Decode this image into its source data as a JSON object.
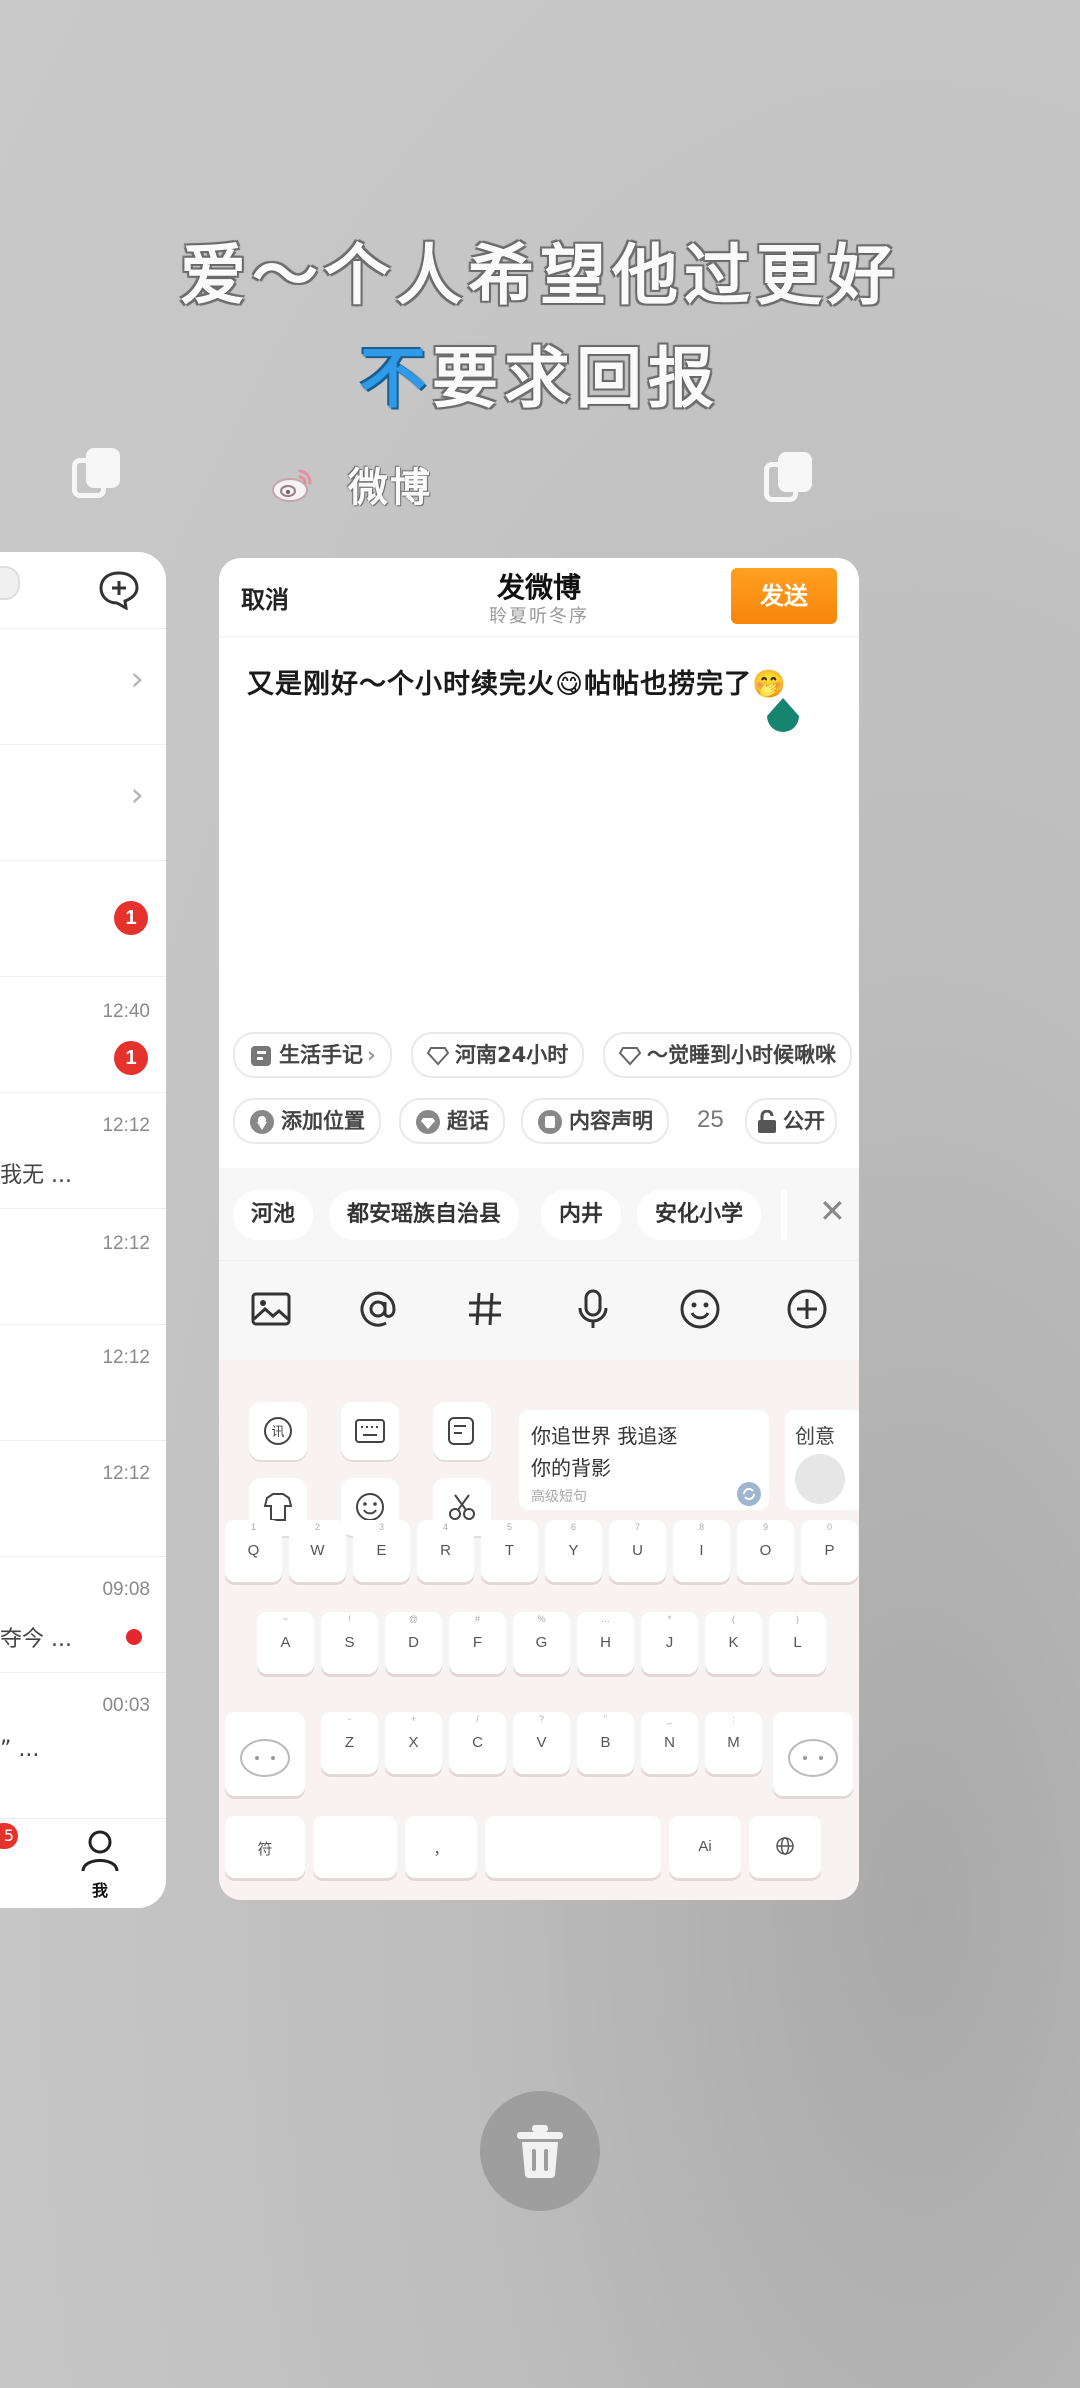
{
  "headline": {
    "line1": "爱〜个人希望他过更好",
    "line2_blue": "不",
    "line2_rest": "要求回报"
  },
  "app": {
    "name": "微博"
  },
  "left_card": {
    "times": [
      "12:40",
      "12:12",
      "12:12",
      "12:12",
      "12:12",
      "09:08",
      "00:03"
    ],
    "badges": [
      "1",
      "1"
    ],
    "snippets": [
      "我无 ...",
      "夺今 ...",
      "” ..."
    ],
    "tab_me": "我",
    "badge_partial": "5"
  },
  "compose": {
    "cancel": "取消",
    "title": "发微博",
    "subtitle": "聆夏听冬序",
    "send": "发送",
    "text": "又是刚好〜个小时续完火😋帖帖也捞完了🤭",
    "topics": [
      "生活手记",
      "河南24小时",
      "〜觉睡到小时候啾咪"
    ],
    "options": [
      "添加位置",
      "超话",
      "内容声明"
    ],
    "char_count": "25",
    "visibility": "公开",
    "suggestions": [
      "河池",
      "都安瑶族自治县",
      "内井",
      "安化小学"
    ]
  },
  "keyboard": {
    "phrase_line1": "你追世界 我追逐",
    "phrase_line2": "你的背影",
    "phrase_hint": "高级短句",
    "phrase2_text": "创意",
    "row1": [
      "Q",
      "W",
      "E",
      "R",
      "T",
      "Y",
      "U",
      "I",
      "O",
      "P"
    ],
    "row1_sub": [
      "1",
      "2",
      "3",
      "4",
      "5",
      "6",
      "7",
      "8",
      "9",
      "0"
    ],
    "row2": [
      "A",
      "S",
      "D",
      "F",
      "G",
      "H",
      "J",
      "K",
      "L"
    ],
    "row2_sub": [
      "~",
      "!",
      "@",
      "#",
      "%",
      "…",
      "*",
      "(",
      ")"
    ],
    "row3": [
      "Z",
      "X",
      "C",
      "V",
      "B",
      "N",
      "M"
    ],
    "row3_sub": [
      "-",
      "+",
      "/",
      "?",
      "\"",
      "_",
      ":"
    ],
    "sym": "符",
    "comma": "，",
    "ai": "Ai",
    "globe": "ἱ0"
  }
}
